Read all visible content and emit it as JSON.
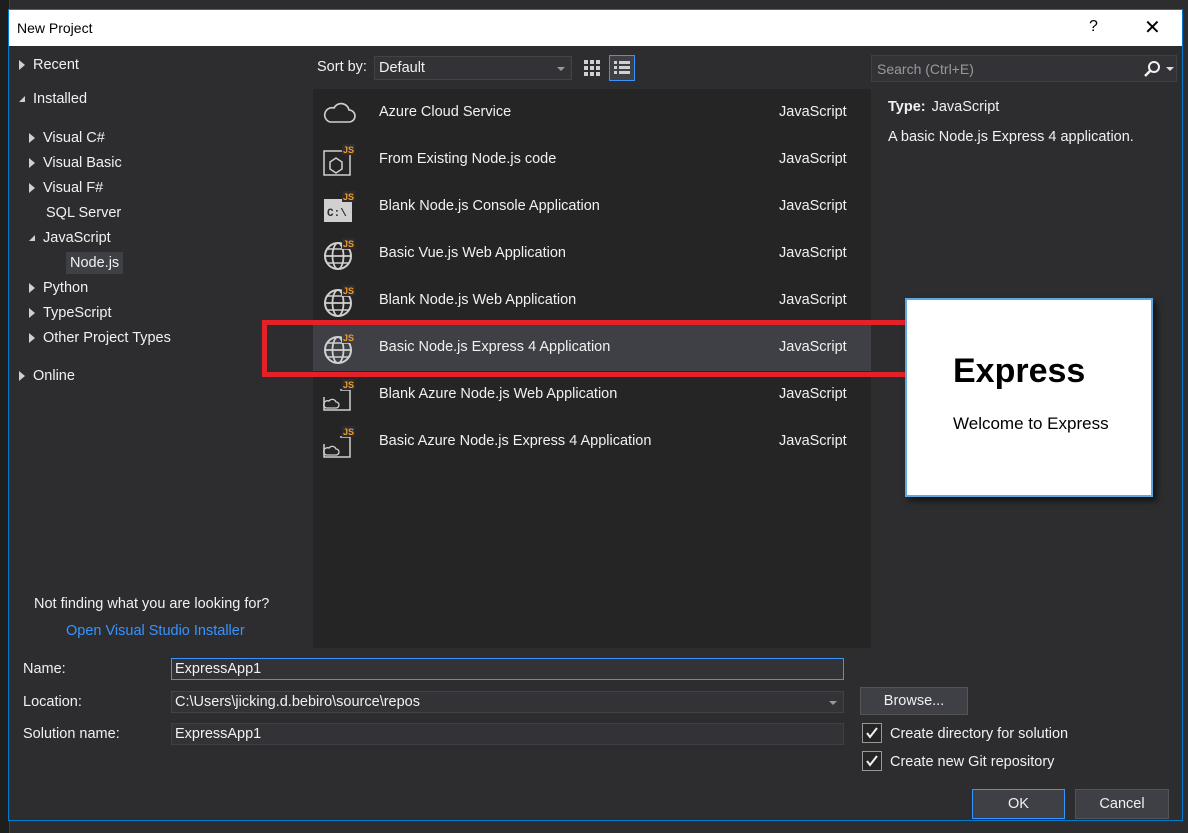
{
  "window": {
    "title": "New Project",
    "help": "?",
    "close": "✕"
  },
  "tree": {
    "recent": "Recent",
    "installed": "Installed",
    "visual_csharp": "Visual C#",
    "visual_basic": "Visual Basic",
    "visual_fsharp": "Visual F#",
    "sql_server": "SQL Server",
    "javascript": "JavaScript",
    "nodejs": "Node.js",
    "python": "Python",
    "typescript": "TypeScript",
    "other": "Other Project Types",
    "online": "Online"
  },
  "not_found": {
    "text": "Not finding what you are looking for?",
    "link": "Open Visual Studio Installer"
  },
  "sort": {
    "label": "Sort by:",
    "value": "Default"
  },
  "search": {
    "placeholder": "Search (Ctrl+E)"
  },
  "templates": [
    {
      "name": "Azure Cloud Service",
      "lang": "JavaScript",
      "icon": "cloud-icon"
    },
    {
      "name": "From Existing Node.js code",
      "lang": "JavaScript",
      "icon": "js-existing-code-icon"
    },
    {
      "name": "Blank Node.js Console Application",
      "lang": "JavaScript",
      "icon": "js-console-icon"
    },
    {
      "name": "Basic Vue.js Web Application",
      "lang": "JavaScript",
      "icon": "js-globe-icon"
    },
    {
      "name": "Blank Node.js Web Application",
      "lang": "JavaScript",
      "icon": "js-globe-icon"
    },
    {
      "name": "Basic Node.js Express 4 Application",
      "lang": "JavaScript",
      "icon": "js-globe-icon",
      "selected": true
    },
    {
      "name": "Blank Azure Node.js Web Application",
      "lang": "JavaScript",
      "icon": "js-azure-icon"
    },
    {
      "name": "Basic Azure Node.js Express 4 Application",
      "lang": "JavaScript",
      "icon": "js-azure-icon"
    }
  ],
  "details": {
    "type_label": "Type:",
    "type_value": "JavaScript",
    "description": "A basic Node.js Express 4 application."
  },
  "preview": {
    "heading": "Express",
    "subtext": "Welcome to Express"
  },
  "form": {
    "name_label": "Name:",
    "name_value": "ExpressApp1",
    "location_label": "Location:",
    "location_value": "C:\\Users\\jicking.d.bebiro\\source\\repos",
    "solution_label": "Solution name:",
    "solution_value": "ExpressApp1",
    "browse": "Browse...",
    "create_dir": "Create directory for solution",
    "create_git": "Create new Git repository",
    "create_dir_checked": true,
    "create_git_checked": true
  },
  "buttons": {
    "ok": "OK",
    "cancel": "Cancel"
  },
  "colors": {
    "accent": "#007acc",
    "link": "#3794ff",
    "highlight_box": "#e32127"
  }
}
